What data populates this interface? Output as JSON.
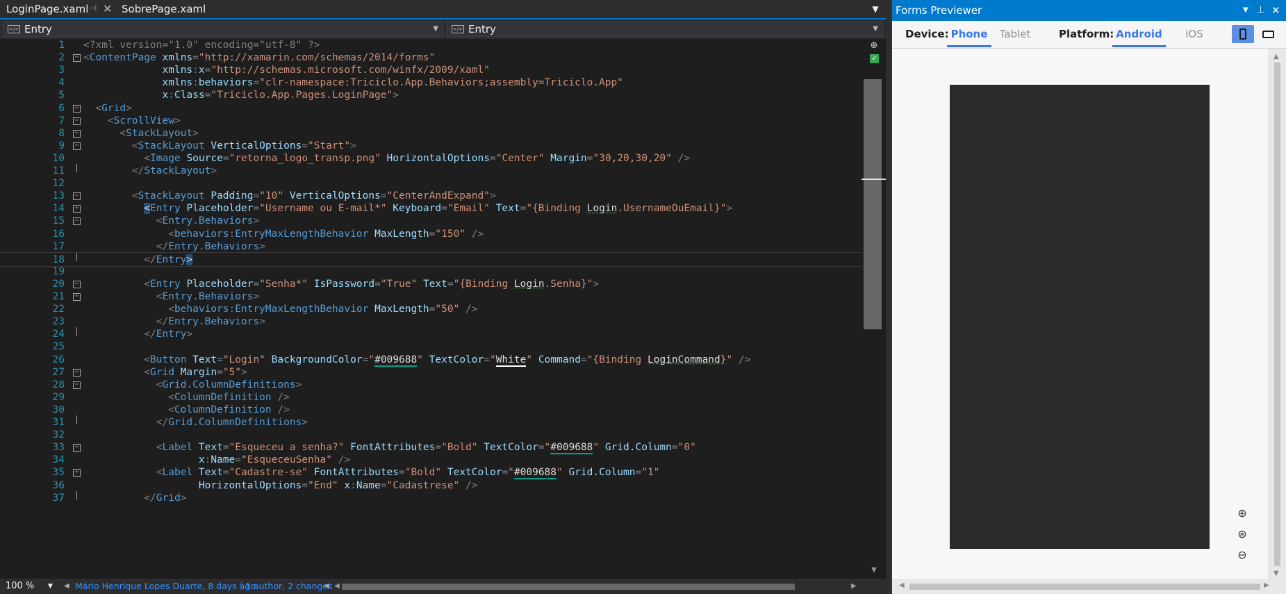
{
  "tabs": [
    {
      "label": "LoginPage.xaml",
      "active": true
    },
    {
      "label": "SobrePage.xaml",
      "active": false
    }
  ],
  "navbar": {
    "left_selector": "Entry",
    "right_selector": "Entry"
  },
  "code_lines": [
    {
      "n": "1",
      "fold": "",
      "t": [
        [
          "pi",
          "<?xml version=\"1.0\" encoding=\"utf-8\" ?>"
        ]
      ]
    },
    {
      "n": "2",
      "fold": "minus",
      "t": [
        [
          "b",
          "<"
        ],
        [
          "el",
          "ContentPage"
        ],
        [
          "txt",
          " "
        ],
        [
          "at",
          "xmlns"
        ],
        [
          "b",
          "="
        ],
        [
          "str",
          "\"http://xamarin.com/schemas/2014/forms\""
        ]
      ]
    },
    {
      "n": "3",
      "fold": "",
      "t": [
        [
          "txt",
          "             "
        ],
        [
          "at",
          "xmlns"
        ],
        [
          "b",
          ":"
        ],
        [
          "at",
          "x"
        ],
        [
          "b",
          "="
        ],
        [
          "str",
          "\"http://schemas.microsoft.com/winfx/2009/xaml\""
        ]
      ]
    },
    {
      "n": "4",
      "fold": "",
      "t": [
        [
          "txt",
          "             "
        ],
        [
          "at",
          "xmlns"
        ],
        [
          "b",
          ":"
        ],
        [
          "at",
          "behaviors"
        ],
        [
          "b",
          "="
        ],
        [
          "str",
          "\"clr-namespace:Triciclo.App.Behaviors;assembly=Triciclo.App\""
        ]
      ]
    },
    {
      "n": "5",
      "fold": "",
      "t": [
        [
          "txt",
          "             "
        ],
        [
          "at",
          "x"
        ],
        [
          "b",
          ":"
        ],
        [
          "at",
          "Class"
        ],
        [
          "b",
          "="
        ],
        [
          "str",
          "\"Triciclo.App.Pages.LoginPage\""
        ],
        [
          "b",
          ">"
        ]
      ]
    },
    {
      "n": "6",
      "fold": "minus",
      "t": [
        [
          "txt",
          "  "
        ],
        [
          "b",
          "<"
        ],
        [
          "el",
          "Grid"
        ],
        [
          "b",
          ">"
        ]
      ]
    },
    {
      "n": "7",
      "fold": "minus",
      "t": [
        [
          "txt",
          "    "
        ],
        [
          "b",
          "<"
        ],
        [
          "el",
          "ScrollView"
        ],
        [
          "b",
          ">"
        ]
      ]
    },
    {
      "n": "8",
      "fold": "minus",
      "t": [
        [
          "txt",
          "      "
        ],
        [
          "b",
          "<"
        ],
        [
          "el",
          "StackLayout"
        ],
        [
          "b",
          ">"
        ]
      ]
    },
    {
      "n": "9",
      "fold": "minus",
      "t": [
        [
          "txt",
          "        "
        ],
        [
          "b",
          "<"
        ],
        [
          "el",
          "StackLayout"
        ],
        [
          "txt",
          " "
        ],
        [
          "at",
          "VerticalOptions"
        ],
        [
          "b",
          "="
        ],
        [
          "str",
          "\"Start\""
        ],
        [
          "b",
          ">"
        ]
      ]
    },
    {
      "n": "10",
      "fold": "",
      "t": [
        [
          "txt",
          "          "
        ],
        [
          "b",
          "<"
        ],
        [
          "el",
          "Image"
        ],
        [
          "txt",
          " "
        ],
        [
          "at",
          "Source"
        ],
        [
          "b",
          "="
        ],
        [
          "str",
          "\"retorna_logo_transp.png\""
        ],
        [
          "txt",
          " "
        ],
        [
          "at",
          "HorizontalOptions"
        ],
        [
          "b",
          "="
        ],
        [
          "str",
          "\"Center\""
        ],
        [
          "txt",
          " "
        ],
        [
          "at",
          "Margin"
        ],
        [
          "b",
          "="
        ],
        [
          "str",
          "\"30,20,30,20\""
        ],
        [
          "txt",
          " "
        ],
        [
          "b",
          "/>"
        ]
      ]
    },
    {
      "n": "11",
      "fold": "end",
      "t": [
        [
          "txt",
          "        "
        ],
        [
          "b",
          "</"
        ],
        [
          "el",
          "StackLayout"
        ],
        [
          "b",
          ">"
        ]
      ]
    },
    {
      "n": "12",
      "fold": "",
      "t": []
    },
    {
      "n": "13",
      "fold": "minus",
      "t": [
        [
          "txt",
          "        "
        ],
        [
          "b",
          "<"
        ],
        [
          "el",
          "StackLayout"
        ],
        [
          "txt",
          " "
        ],
        [
          "at",
          "Padding"
        ],
        [
          "b",
          "="
        ],
        [
          "str",
          "\"10\""
        ],
        [
          "txt",
          " "
        ],
        [
          "at",
          "VerticalOptions"
        ],
        [
          "b",
          "="
        ],
        [
          "str",
          "\"CenterAndExpand\""
        ],
        [
          "b",
          ">"
        ]
      ]
    },
    {
      "n": "14",
      "fold": "minus",
      "t": [
        [
          "txt",
          "          "
        ],
        [
          "hl",
          "<"
        ],
        [
          "el",
          "Entry"
        ],
        [
          "txt",
          " "
        ],
        [
          "at",
          "Placeholder"
        ],
        [
          "b",
          "="
        ],
        [
          "str",
          "\"Username ou E-mail*\""
        ],
        [
          "txt",
          " "
        ],
        [
          "at",
          "Keyboard"
        ],
        [
          "b",
          "="
        ],
        [
          "str",
          "\"Email\""
        ],
        [
          "txt",
          " "
        ],
        [
          "at",
          "Text"
        ],
        [
          "b",
          "="
        ],
        [
          "str",
          "\"{Binding "
        ],
        [
          "sq",
          "Login"
        ],
        [
          "str",
          ".UsernameOuEmail}\""
        ],
        [
          "b",
          ">"
        ]
      ]
    },
    {
      "n": "15",
      "fold": "minus",
      "t": [
        [
          "txt",
          "            "
        ],
        [
          "b",
          "<"
        ],
        [
          "el",
          "Entry.Behaviors"
        ],
        [
          "b",
          ">"
        ]
      ]
    },
    {
      "n": "16",
      "fold": "",
      "t": [
        [
          "txt",
          "              "
        ],
        [
          "b",
          "<"
        ],
        [
          "el",
          "behaviors"
        ],
        [
          "b",
          ":"
        ],
        [
          "el",
          "EntryMaxLengthBehavior"
        ],
        [
          "txt",
          " "
        ],
        [
          "at",
          "MaxLength"
        ],
        [
          "b",
          "="
        ],
        [
          "str",
          "\"150\""
        ],
        [
          "txt",
          " "
        ],
        [
          "b",
          "/>"
        ]
      ]
    },
    {
      "n": "17",
      "fold": "",
      "t": [
        [
          "txt",
          "            "
        ],
        [
          "b",
          "</"
        ],
        [
          "el",
          "Entry.Behaviors"
        ],
        [
          "b",
          ">"
        ]
      ]
    },
    {
      "n": "18",
      "fold": "end",
      "current": true,
      "t": [
        [
          "txt",
          "          "
        ],
        [
          "b",
          "</"
        ],
        [
          "el",
          "Entry"
        ],
        [
          "hl",
          ">"
        ]
      ]
    },
    {
      "n": "19",
      "fold": "",
      "t": []
    },
    {
      "n": "20",
      "fold": "minus",
      "t": [
        [
          "txt",
          "          "
        ],
        [
          "b",
          "<"
        ],
        [
          "el",
          "Entry"
        ],
        [
          "txt",
          " "
        ],
        [
          "at",
          "Placeholder"
        ],
        [
          "b",
          "="
        ],
        [
          "str",
          "\"Senha*\""
        ],
        [
          "txt",
          " "
        ],
        [
          "at",
          "IsPassword"
        ],
        [
          "b",
          "="
        ],
        [
          "str",
          "\"True\""
        ],
        [
          "txt",
          " "
        ],
        [
          "at",
          "Text"
        ],
        [
          "b",
          "="
        ],
        [
          "str",
          "\"{Binding "
        ],
        [
          "sq",
          "Login"
        ],
        [
          "str",
          ".Senha}\""
        ],
        [
          "b",
          ">"
        ]
      ]
    },
    {
      "n": "21",
      "fold": "minus",
      "t": [
        [
          "txt",
          "            "
        ],
        [
          "b",
          "<"
        ],
        [
          "el",
          "Entry.Behaviors"
        ],
        [
          "b",
          ">"
        ]
      ]
    },
    {
      "n": "22",
      "fold": "",
      "t": [
        [
          "txt",
          "              "
        ],
        [
          "b",
          "<"
        ],
        [
          "el",
          "behaviors"
        ],
        [
          "b",
          ":"
        ],
        [
          "el",
          "EntryMaxLengthBehavior"
        ],
        [
          "txt",
          " "
        ],
        [
          "at",
          "MaxLength"
        ],
        [
          "b",
          "="
        ],
        [
          "str",
          "\"50\""
        ],
        [
          "txt",
          " "
        ],
        [
          "b",
          "/>"
        ]
      ]
    },
    {
      "n": "23",
      "fold": "",
      "t": [
        [
          "txt",
          "            "
        ],
        [
          "b",
          "</"
        ],
        [
          "el",
          "Entry.Behaviors"
        ],
        [
          "b",
          ">"
        ]
      ]
    },
    {
      "n": "24",
      "fold": "end",
      "t": [
        [
          "txt",
          "          "
        ],
        [
          "b",
          "</"
        ],
        [
          "el",
          "Entry"
        ],
        [
          "b",
          ">"
        ]
      ]
    },
    {
      "n": "25",
      "fold": "",
      "t": []
    },
    {
      "n": "26",
      "fold": "",
      "t": [
        [
          "txt",
          "          "
        ],
        [
          "b",
          "<"
        ],
        [
          "el",
          "Button"
        ],
        [
          "txt",
          " "
        ],
        [
          "at",
          "Text"
        ],
        [
          "b",
          "="
        ],
        [
          "str",
          "\"Login\""
        ],
        [
          "txt",
          " "
        ],
        [
          "at",
          "BackgroundColor"
        ],
        [
          "b",
          "="
        ],
        [
          "str",
          "\""
        ],
        [
          "col",
          "#009688"
        ],
        [
          "str",
          "\""
        ],
        [
          "txt",
          " "
        ],
        [
          "at",
          "TextColor"
        ],
        [
          "b",
          "="
        ],
        [
          "str",
          "\""
        ],
        [
          "wht",
          "White"
        ],
        [
          "str",
          "\""
        ],
        [
          "txt",
          " "
        ],
        [
          "at",
          "Command"
        ],
        [
          "b",
          "="
        ],
        [
          "str",
          "\"{Binding "
        ],
        [
          "sq",
          "LoginCommand"
        ],
        [
          "str",
          "}\""
        ],
        [
          "txt",
          " "
        ],
        [
          "b",
          "/>"
        ]
      ]
    },
    {
      "n": "27",
      "fold": "minus",
      "t": [
        [
          "txt",
          "          "
        ],
        [
          "b",
          "<"
        ],
        [
          "el",
          "Grid"
        ],
        [
          "txt",
          " "
        ],
        [
          "at",
          "Margin"
        ],
        [
          "b",
          "="
        ],
        [
          "str",
          "\"5\""
        ],
        [
          "b",
          ">"
        ]
      ]
    },
    {
      "n": "28",
      "fold": "minus",
      "t": [
        [
          "txt",
          "            "
        ],
        [
          "b",
          "<"
        ],
        [
          "el",
          "Grid.ColumnDefinitions"
        ],
        [
          "b",
          ">"
        ]
      ]
    },
    {
      "n": "29",
      "fold": "",
      "t": [
        [
          "txt",
          "              "
        ],
        [
          "b",
          "<"
        ],
        [
          "el",
          "ColumnDefinition"
        ],
        [
          "txt",
          " "
        ],
        [
          "b",
          "/>"
        ]
      ]
    },
    {
      "n": "30",
      "fold": "",
      "t": [
        [
          "txt",
          "              "
        ],
        [
          "b",
          "<"
        ],
        [
          "el",
          "ColumnDefinition"
        ],
        [
          "txt",
          " "
        ],
        [
          "b",
          "/>"
        ]
      ]
    },
    {
      "n": "31",
      "fold": "end",
      "t": [
        [
          "txt",
          "            "
        ],
        [
          "b",
          "</"
        ],
        [
          "el",
          "Grid.ColumnDefinitions"
        ],
        [
          "b",
          ">"
        ]
      ]
    },
    {
      "n": "32",
      "fold": "",
      "t": []
    },
    {
      "n": "33",
      "fold": "minus",
      "t": [
        [
          "txt",
          "            "
        ],
        [
          "b",
          "<"
        ],
        [
          "el",
          "Label"
        ],
        [
          "txt",
          " "
        ],
        [
          "at",
          "Text"
        ],
        [
          "b",
          "="
        ],
        [
          "str",
          "\"Esqueceu a senha?\""
        ],
        [
          "txt",
          " "
        ],
        [
          "at",
          "FontAttributes"
        ],
        [
          "b",
          "="
        ],
        [
          "str",
          "\"Bold\""
        ],
        [
          "txt",
          " "
        ],
        [
          "at",
          "TextColor"
        ],
        [
          "b",
          "="
        ],
        [
          "str",
          "\""
        ],
        [
          "col",
          "#009688"
        ],
        [
          "str",
          "\""
        ],
        [
          "txt",
          " "
        ],
        [
          "at",
          "Grid.Column"
        ],
        [
          "b",
          "="
        ],
        [
          "str",
          "\"0\""
        ]
      ]
    },
    {
      "n": "34",
      "fold": "",
      "t": [
        [
          "txt",
          "                   "
        ],
        [
          "at",
          "x"
        ],
        [
          "b",
          ":"
        ],
        [
          "at",
          "Name"
        ],
        [
          "b",
          "="
        ],
        [
          "str",
          "\"EsqueceuSenha\""
        ],
        [
          "txt",
          " "
        ],
        [
          "b",
          "/>"
        ]
      ]
    },
    {
      "n": "35",
      "fold": "minus",
      "t": [
        [
          "txt",
          "            "
        ],
        [
          "b",
          "<"
        ],
        [
          "el",
          "Label"
        ],
        [
          "txt",
          " "
        ],
        [
          "at",
          "Text"
        ],
        [
          "b",
          "="
        ],
        [
          "str",
          "\"Cadastre-se\""
        ],
        [
          "txt",
          " "
        ],
        [
          "at",
          "FontAttributes"
        ],
        [
          "b",
          "="
        ],
        [
          "str",
          "\"Bold\""
        ],
        [
          "txt",
          " "
        ],
        [
          "at",
          "TextColor"
        ],
        [
          "b",
          "="
        ],
        [
          "str",
          "\""
        ],
        [
          "col",
          "#009688"
        ],
        [
          "str",
          "\""
        ],
        [
          "txt",
          " "
        ],
        [
          "at",
          "Grid.Column"
        ],
        [
          "b",
          "="
        ],
        [
          "str",
          "\"1\""
        ]
      ]
    },
    {
      "n": "36",
      "fold": "",
      "t": [
        [
          "txt",
          "                   "
        ],
        [
          "at",
          "HorizontalOptions"
        ],
        [
          "b",
          "="
        ],
        [
          "str",
          "\"End\""
        ],
        [
          "txt",
          " "
        ],
        [
          "at",
          "x"
        ],
        [
          "b",
          ":"
        ],
        [
          "at",
          "Name"
        ],
        [
          "b",
          "="
        ],
        [
          "str",
          "\"Cadastrese\""
        ],
        [
          "txt",
          " "
        ],
        [
          "b",
          "/>"
        ]
      ]
    },
    {
      "n": "37",
      "fold": "end",
      "t": [
        [
          "txt",
          "          "
        ],
        [
          "b",
          "</"
        ],
        [
          "el",
          "Grid"
        ],
        [
          "b",
          ">"
        ]
      ]
    }
  ],
  "status": {
    "zoom": "100 %",
    "blame_author": "Mário Henrique Lopes Duarte, 8 days ago",
    "blame_changes": "1 author, 2 changes"
  },
  "previewer": {
    "title": "Forms Previewer",
    "device_label": "Device:",
    "device_tabs": [
      {
        "label": "Phone",
        "active": true
      },
      {
        "label": "Tablet",
        "active": false
      }
    ],
    "platform_label": "Platform:",
    "platform_tabs": [
      {
        "label": "Android",
        "active": true
      },
      {
        "label": "iOS",
        "active": false
      }
    ],
    "orientation": "portrait"
  },
  "icons": {
    "tab_pin": "pin-icon",
    "tab_close": "close-icon",
    "dropdown": "chevron-down-icon",
    "zoom_in": "zoom-in-icon",
    "zoom_fit": "zoom-fit-icon",
    "zoom_out": "zoom-out-icon"
  },
  "colors": {
    "accent": "#007acc",
    "previewer_active_tab": "#3b78e7",
    "phone_screen": "#2b2b2b"
  }
}
